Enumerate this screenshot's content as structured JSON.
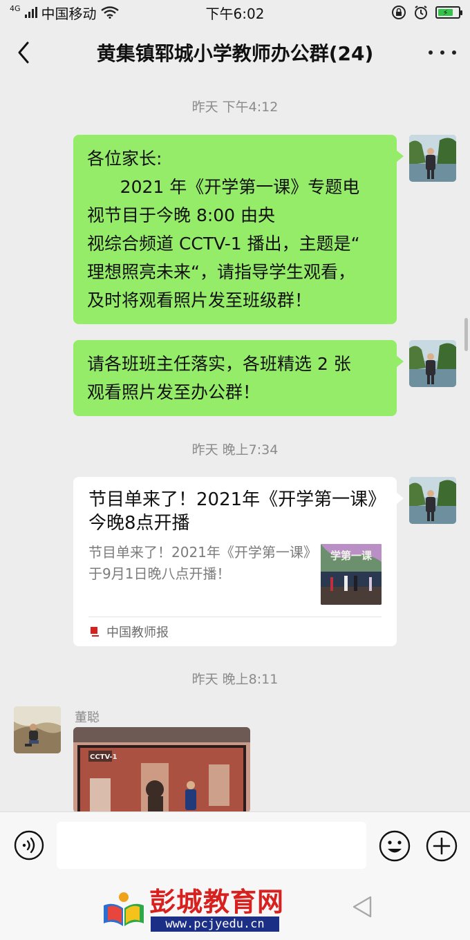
{
  "status_bar": {
    "network": "4G",
    "carrier": "中国移动",
    "time": "下午6:02",
    "battery_level": 0.75,
    "icons": [
      "signal-icon",
      "wifi-icon",
      "lock-rotation-icon",
      "alarm-icon",
      "battery-icon"
    ]
  },
  "header": {
    "title": "黄集镇郓城小学教师办公群(24)",
    "icons": [
      "back-icon",
      "more-icon"
    ]
  },
  "messages": [
    {
      "timestamp": "昨天 下午4:12",
      "lines": [
        "各位家长:",
        "      2021 年《开学第一课》专题电",
        "视节目于今晚 8:00 由央",
        "视综合频道 CCTV-1 播出，主题是“",
        "理想照亮未来“，请指导学生观看，",
        "及时将观看照片发至班级群！"
      ]
    },
    {
      "lines": [
        "请各班班主任落实，各班精选 2 张",
        "观看照片发至办公群！"
      ]
    },
    {
      "timestamp": "昨天 晚上7:34",
      "card": {
        "title": "节目单来了！2021年《开学第一课》今晚8点开播",
        "description": "节目单来了！2021年《开学第一课》于9月1日晚八点开播！",
        "source": "中国教师报",
        "thumb_text": "学第一课"
      }
    },
    {
      "timestamp": "昨天 晚上8:11",
      "sender": "董聪",
      "photo_caption": "CCTV-1"
    }
  ],
  "input_bar": {
    "icons": [
      "voice-icon",
      "emoji-icon",
      "plus-icon"
    ]
  },
  "watermark": {
    "name": "彭城教育网",
    "url": "www.pcjyedu.cn"
  },
  "colors": {
    "bubble": "#95ec69",
    "background": "#ededed",
    "watermark_red": "#d8201e",
    "watermark_blue": "#1c2f86"
  }
}
